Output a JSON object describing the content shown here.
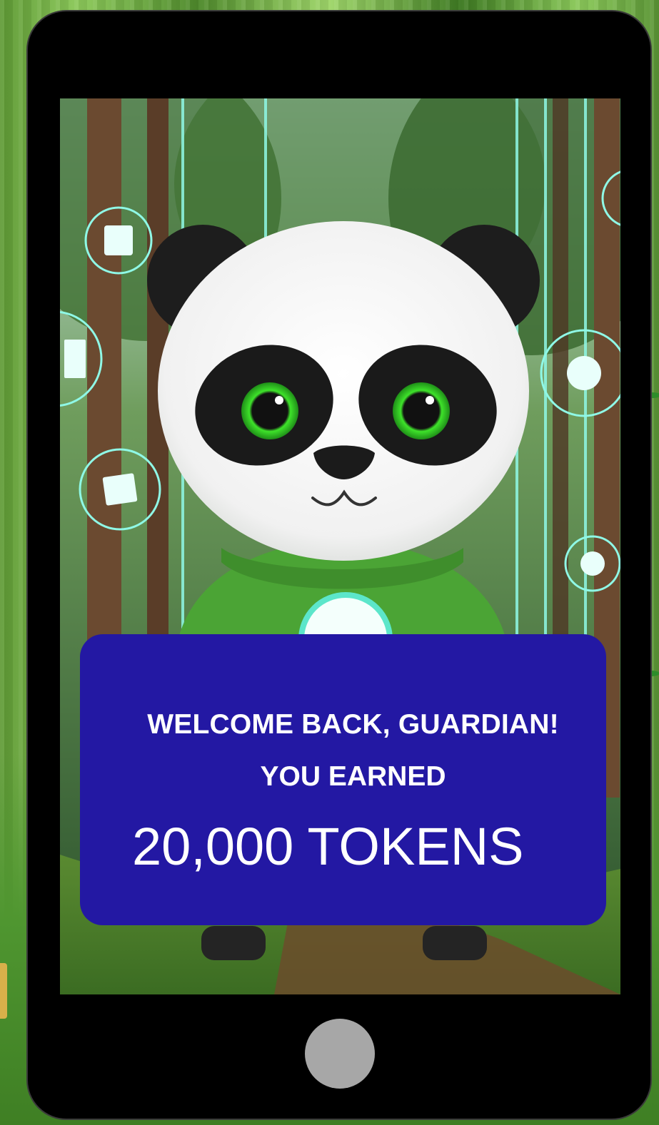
{
  "card": {
    "welcome": "WELCOME BACK, GUARDIAN!",
    "earned": "YOU EARNED",
    "tokens": "20,000 TOKENS"
  },
  "colors": {
    "card_background": "#2318a3",
    "card_text": "#ffffff",
    "phone_body": "#000000",
    "home_button": "#a7a7a7",
    "panda_eyes": "#39e62e",
    "hologram": "#7ff6e3",
    "hoodie": "#4ba435"
  },
  "icons": {
    "hologram_left_1": "building-icon",
    "hologram_left_2": "document-icon",
    "hologram_left_3": "map-icon",
    "hologram_right_1": "sun-icon",
    "hologram_right_2": "recycle-icon",
    "home": "home-button"
  }
}
